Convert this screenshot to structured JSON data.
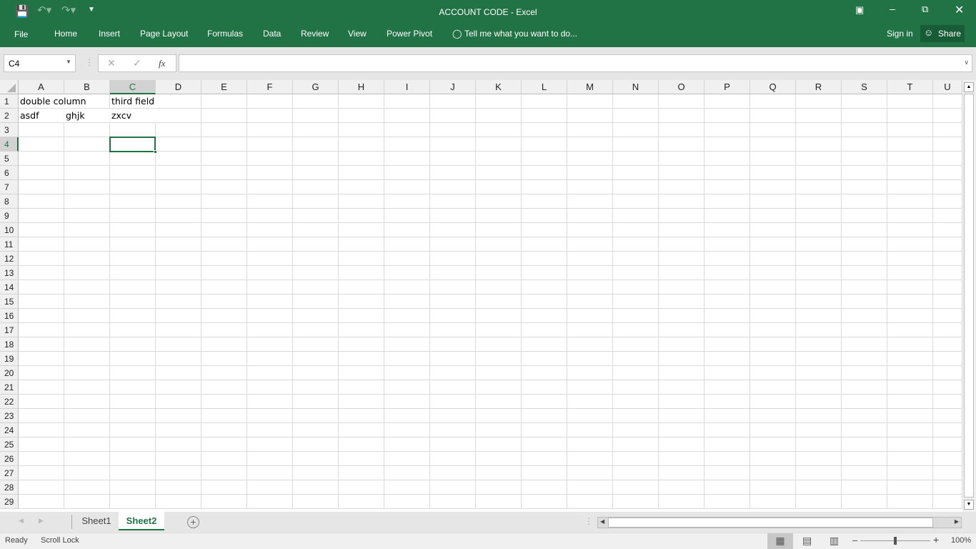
{
  "title": "ACCOUNT CODE - Excel",
  "ribbon": {
    "tabs": [
      "File",
      "Home",
      "Insert",
      "Page Layout",
      "Formulas",
      "Data",
      "Review",
      "View",
      "Power Pivot"
    ],
    "tell_me": "Tell me what you want to do...",
    "sign_in": "Sign in",
    "share": "Share"
  },
  "formula_bar": {
    "name_box": "C4",
    "fx": "fx",
    "formula": ""
  },
  "grid": {
    "columns": [
      "A",
      "B",
      "C",
      "D",
      "E",
      "F",
      "G",
      "H",
      "I",
      "J",
      "K",
      "L",
      "M",
      "N",
      "O",
      "P",
      "Q",
      "R",
      "S",
      "T",
      "U"
    ],
    "row_count": 29,
    "selected_col": "C",
    "selected_row": 4,
    "cells": {
      "A1": "double column",
      "C1": "third field",
      "A2": "asdf",
      "B2": "ghjk",
      "C2": "zxcv"
    }
  },
  "sheets": {
    "tabs": [
      "Sheet1",
      "Sheet2"
    ],
    "active": "Sheet2"
  },
  "status": {
    "ready": "Ready",
    "scroll_lock": "Scroll Lock",
    "zoom": "100%"
  },
  "colors": {
    "accent": "#217346"
  }
}
